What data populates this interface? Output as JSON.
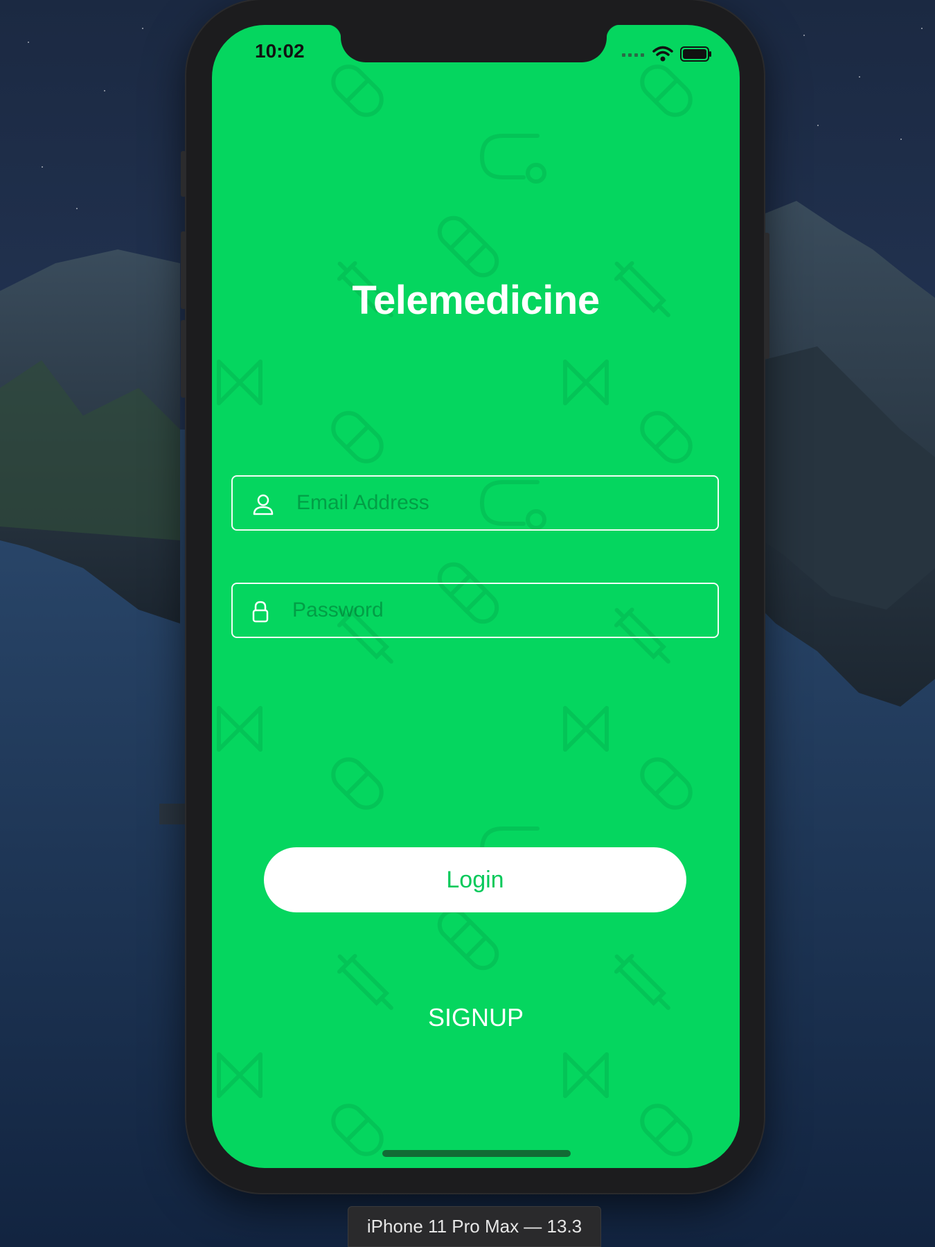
{
  "status_bar": {
    "time": "10:02",
    "icons": [
      "cellular-signal-icon",
      "wifi-icon",
      "battery-icon"
    ]
  },
  "app": {
    "title": "Telemedicine",
    "email": {
      "placeholder": "Email Address",
      "value": ""
    },
    "password": {
      "placeholder": "Password",
      "value": ""
    },
    "login_label": "Login",
    "signup_label": "SIGNUP",
    "background_pattern_icons": [
      "pill-icon",
      "bandage-icon",
      "syringe-icon",
      "dna-icon",
      "stethoscope-icon"
    ]
  },
  "simulator": {
    "device_label": "iPhone 11 Pro Max — 13.3"
  },
  "colors": {
    "accent_green": "#05d65f",
    "button_text_green": "#05c95a",
    "white": "#ffffff"
  }
}
